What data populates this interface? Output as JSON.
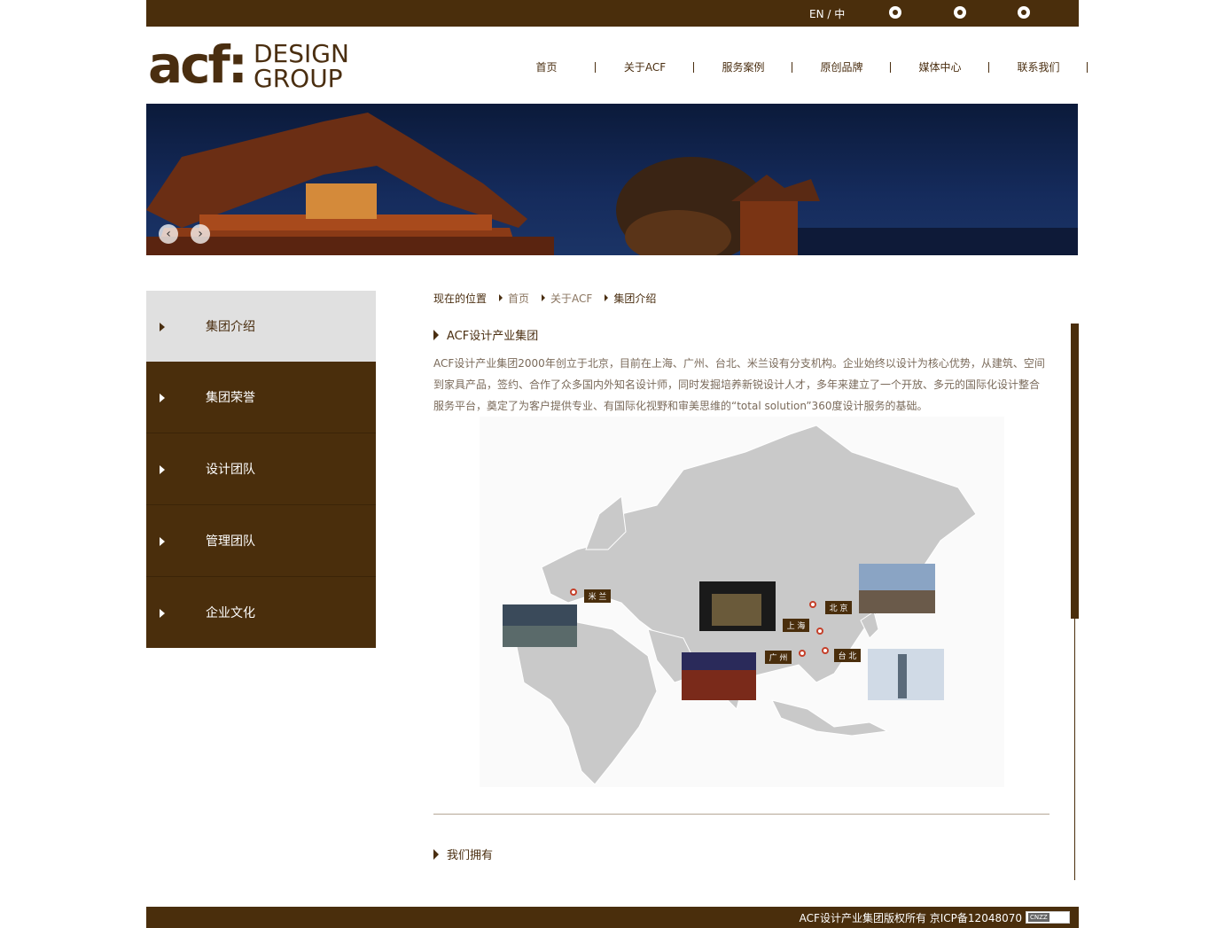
{
  "topbar": {
    "language": "EN / 中",
    "icons": [
      "wechat-icon",
      "weibo-icon",
      "world-icon"
    ]
  },
  "header": {
    "logo_mark": "acf:",
    "logo_line1": "DESIGN",
    "logo_line2": "GROUP",
    "nav": [
      "首页",
      "关于ACF",
      "服务案例",
      "原创品牌",
      "媒体中心",
      "联系我们"
    ]
  },
  "banner": {
    "prev_label": "‹",
    "next_label": "›"
  },
  "sidebar": {
    "items": [
      {
        "label": "集团介绍",
        "active": true
      },
      {
        "label": "集团荣誉",
        "active": false
      },
      {
        "label": "设计团队",
        "active": false
      },
      {
        "label": "管理团队",
        "active": false
      },
      {
        "label": "企业文化",
        "active": false
      }
    ]
  },
  "breadcrumb": {
    "prefix": "现在的位置",
    "items": [
      "首页",
      "关于ACF",
      "集团介绍"
    ]
  },
  "content": {
    "title": "ACF设计产业集团",
    "paragraph": "ACF设计产业集团2000年创立于北京，目前在上海、广州、台北、米兰设有分支机构。企业始终以设计为核心优势，从建筑、空间到家具产品，签约、合作了众多国内外知名设计师，同时发掘培养新锐设计人才，多年来建立了一个开放、多元的国际化设计整合服务平台，奠定了为客户提供专业、有国际化视野和审美思维的“total solution”360度设计服务的基础。",
    "map_labels": {
      "milan": "米 兰",
      "beijing": "北 京",
      "shanghai": "上 海",
      "guangzhou": "广 州",
      "taipei": "台 北"
    },
    "section2_title": "我们拥有"
  },
  "footer": {
    "copyright": "ACF设计产业集团版权所有 京ICP备12048070",
    "badge": "CNZZ"
  },
  "colors": {
    "brand_brown": "#4a2e0c",
    "active_grey": "#e0e0e0",
    "map_grey": "#c9c9c9"
  }
}
